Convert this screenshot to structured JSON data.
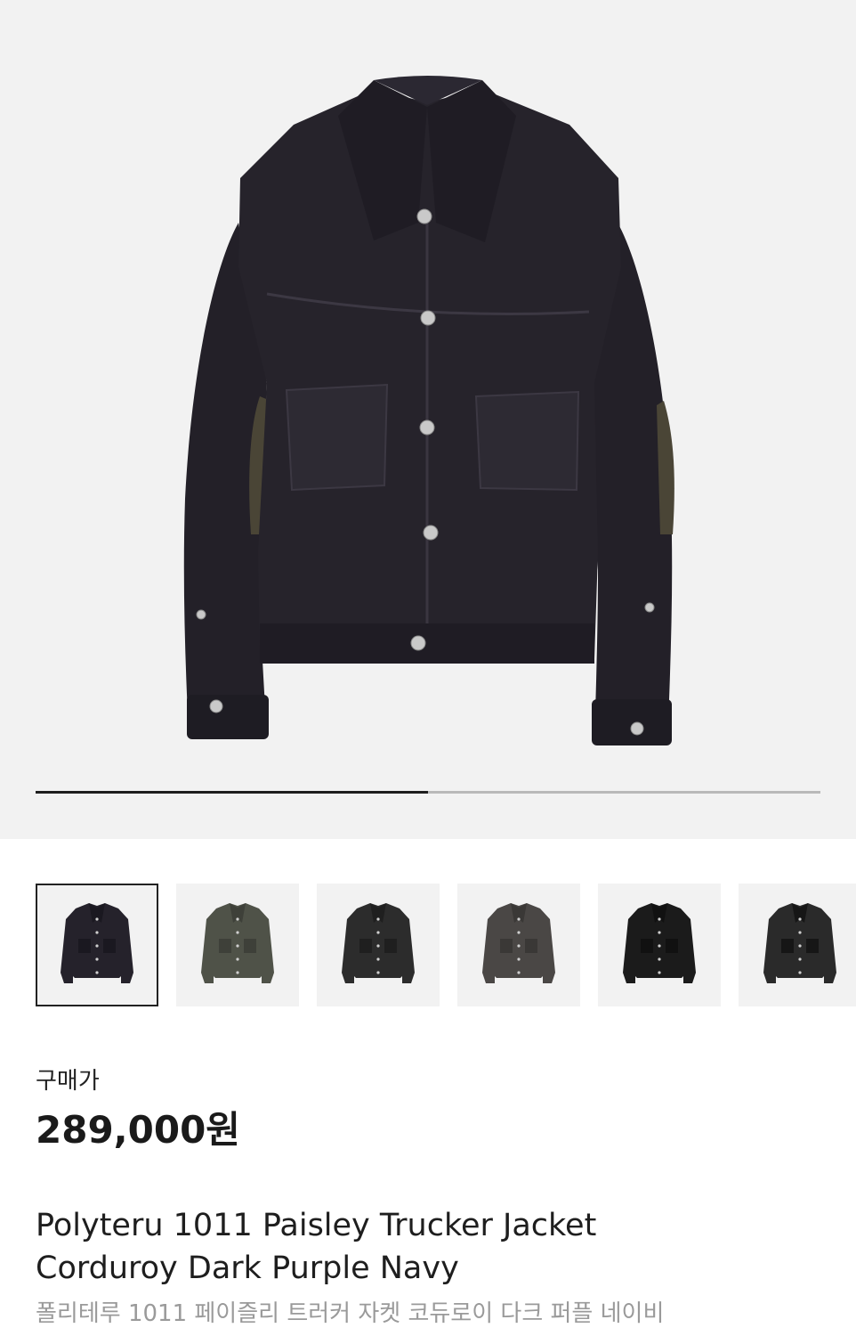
{
  "gallery": {
    "image_icon": "jacket-image",
    "slide_progress": 0.5,
    "thumbnails": [
      {
        "name": "thumb-dark-purple-navy",
        "body": "#25222b",
        "shade": "#1a1820",
        "selected": true
      },
      {
        "name": "thumb-olive",
        "body": "#4f5248",
        "shade": "#3e4039",
        "selected": false
      },
      {
        "name": "thumb-black-washed",
        "body": "#2c2c2c",
        "shade": "#1f1f1f",
        "selected": false
      },
      {
        "name": "thumb-faded-grey",
        "body": "#4a4745",
        "shade": "#3a3836",
        "selected": false
      },
      {
        "name": "thumb-black",
        "body": "#1b1b1b",
        "shade": "#111111",
        "selected": false
      },
      {
        "name": "thumb-black-faded",
        "body": "#2a2a2a",
        "shade": "#161616",
        "selected": false
      }
    ]
  },
  "product": {
    "price_label": "구매가",
    "price": "289,000원",
    "title_line1": "Polyteru 1011 Paisley Trucker Jacket",
    "title_line2": "Corduroy Dark Purple Navy",
    "subtitle": "폴리테루 1011 페이즐리 트러커 자켓 코듀로이 다크 퍼플 네이비"
  },
  "colors": {
    "hero_bg": "#f2f2f2",
    "jacket": "#26232b",
    "jacket_shadow": "#1a181f",
    "stitch": "#45414c",
    "button": "#c9c9c9",
    "paisley_patch": "#4a4536"
  }
}
